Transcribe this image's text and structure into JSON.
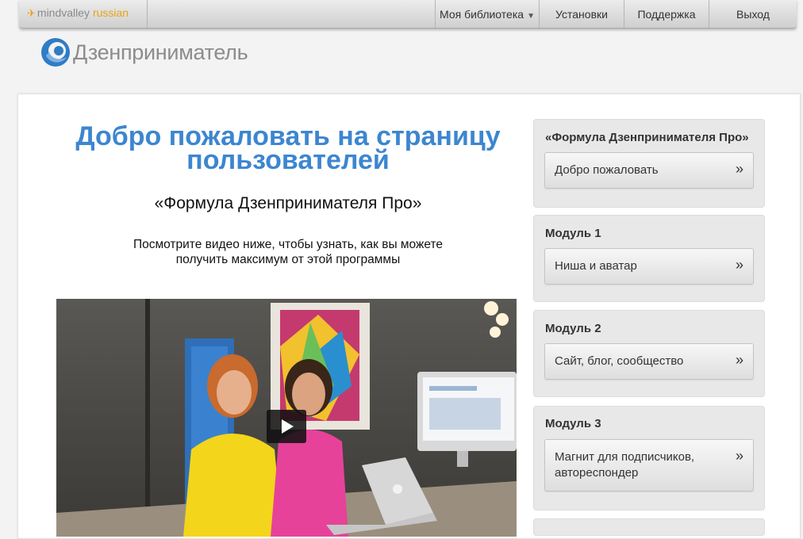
{
  "topbar": {
    "brand_main": "mindvalley",
    "brand_accent": "russian",
    "nav": {
      "library": "Моя библиотека",
      "settings": "Установки",
      "support": "Поддержка",
      "logout": "Выход"
    }
  },
  "logo": {
    "text": "Дзенприниматель"
  },
  "main": {
    "welcome_line1": "Добро пожаловать на страницу",
    "welcome_line2": "пользователей",
    "course_title": "«Формула Дзенпринимателя Про»",
    "subtext_line1": "Посмотрите видео ниже, чтобы узнать, как вы можете",
    "subtext_line2": "получить максимум от этой программы"
  },
  "sidebar": {
    "boxes": [
      {
        "heading": "«Формула Дзенпринимателя Про»",
        "item": "Добро пожаловать"
      },
      {
        "heading": "Модуль 1",
        "item": "Ниша и аватар"
      },
      {
        "heading": "Модуль 2",
        "item": "Сайт, блог, сообщество"
      },
      {
        "heading": "Модуль 3",
        "item_line1": "Магнит для подписчиков,",
        "item_line2": "автореспондер"
      }
    ],
    "arrow": "»"
  },
  "colors": {
    "accent_blue": "#3d86cf",
    "brand_orange": "#e8a317"
  }
}
